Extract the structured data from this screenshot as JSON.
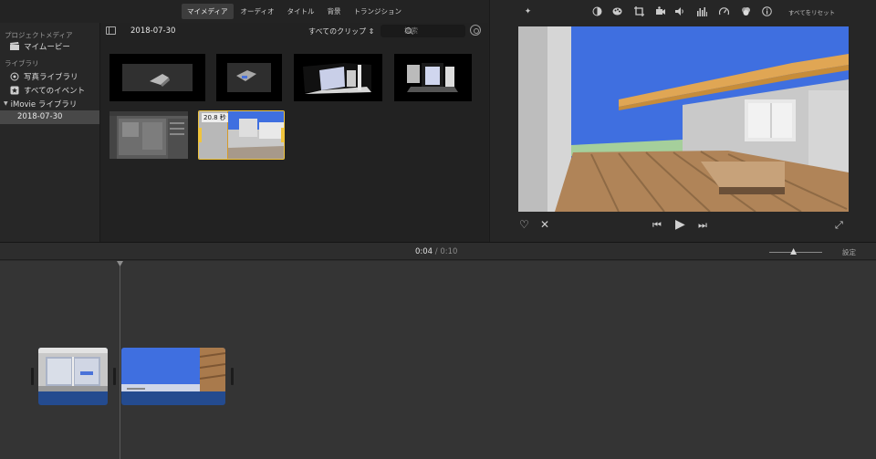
{
  "tabs": [
    "マイメディア",
    "オーディオ",
    "タイトル",
    "背景",
    "トランジション"
  ],
  "sidebar": {
    "project_media_heading": "プロジェクトメディア",
    "my_movie": "マイムービー",
    "library_heading": "ライブラリ",
    "photos_library": "写真ライブラリ",
    "all_events": "すべてのイベント",
    "imovie_library": "iMovie ライブラリ",
    "event_selected": "2018-07-30"
  },
  "browser": {
    "event_title": "2018-07-30",
    "clip_filter": "すべてのクリップ",
    "search_placeholder": "検索",
    "selected_clip_duration": "20.8 秒"
  },
  "viewer": {
    "reset_all": "すべてをリセット"
  },
  "timeline": {
    "current_time": "0:04",
    "separator": "/",
    "total_time": "0:10",
    "settings": "設定",
    "zoom_level": 0.45
  },
  "colors": {
    "accent_selection": "#f0c43c",
    "clip_bar": "#244b8f",
    "sky": "#3f6fe0"
  }
}
